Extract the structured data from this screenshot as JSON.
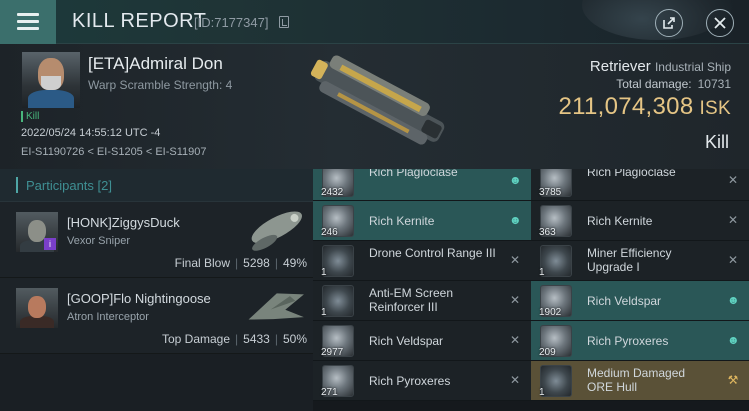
{
  "header": {
    "title": "KILL REPORT",
    "id_text": "[ID:7177347]"
  },
  "victim": {
    "name": "[ETA]Admiral Don",
    "warp_scramble": "Warp Scramble Strength: 4",
    "kill_tag": "Kill",
    "datetime": "2022/05/24 14:55:12 UTC -4",
    "location": "EI-S1190726 < EI-S1205 < EI-S11907",
    "ship_name": "Retriever",
    "ship_class": "Industrial Ship",
    "total_damage_label": "Total damage:",
    "total_damage": "10731",
    "isk_value": "211,074,308",
    "isk_unit": "ISK",
    "result": "Kill"
  },
  "participants": {
    "label": "Participants",
    "count": "[2]",
    "list": [
      {
        "name": "[HONK]ZiggysDuck",
        "ship": "Vexor Sniper",
        "role": "Final Blow",
        "damage": "5298",
        "percent": "49%",
        "badge": "i"
      },
      {
        "name": "[GOOP]Flo Nightingoose",
        "ship": "Atron Interceptor",
        "role": "Top Damage",
        "damage": "5433",
        "percent": "50%",
        "badge": ""
      }
    ]
  },
  "items_left": [
    {
      "qty": "2432",
      "name": "Rich Plagioclase",
      "state": "dropped"
    },
    {
      "qty": "246",
      "name": "Rich Kernite",
      "state": "dropped"
    },
    {
      "qty": "1",
      "name": "Drone Control Range III",
      "state": "destroyed"
    },
    {
      "qty": "1",
      "name": "Anti-EM Screen Reinforcer III",
      "state": "destroyed"
    },
    {
      "qty": "2977",
      "name": "Rich Veldspar",
      "state": "destroyed"
    },
    {
      "qty": "271",
      "name": "Rich Pyroxeres",
      "state": "destroyed"
    }
  ],
  "items_right": [
    {
      "qty": "3785",
      "name": "Rich Plagioclase",
      "state": "destroyed"
    },
    {
      "qty": "363",
      "name": "Rich Kernite",
      "state": "destroyed"
    },
    {
      "qty": "1",
      "name": "Miner Efficiency Upgrade I",
      "state": "destroyed"
    },
    {
      "qty": "1902",
      "name": "Rich Veldspar",
      "state": "dropped"
    },
    {
      "qty": "209",
      "name": "Rich Pyroxeres",
      "state": "dropped"
    },
    {
      "qty": "1",
      "name": "Medium Damaged ORE Hull",
      "state": "fitted"
    }
  ],
  "icons": {
    "menu": "hamburger-icon",
    "copy": "copy-icon",
    "share": "share-icon",
    "close": "close-icon",
    "dropped": "person-icon",
    "destroyed": "x-icon",
    "fitted": "wrench-icon"
  },
  "colors": {
    "accent": "#3b6f6c",
    "isk": "#e5c585",
    "dropped_row": "#2a5757",
    "fitted_row": "#5a5137",
    "kill_green": "#48b67c"
  }
}
